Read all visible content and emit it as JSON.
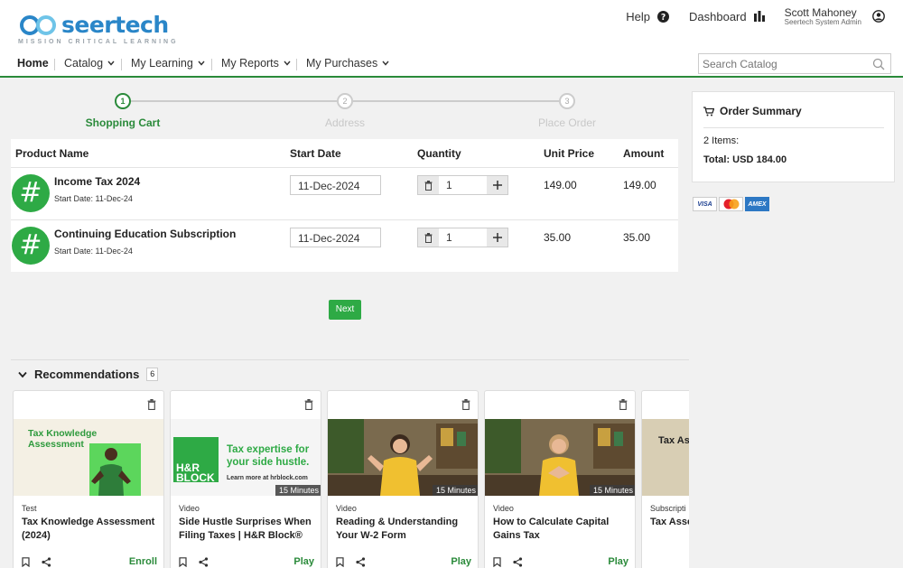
{
  "brand": {
    "name": "seertech",
    "tagline": "MISSION CRITICAL LEARNING"
  },
  "header": {
    "help": "Help",
    "dashboard": "Dashboard",
    "user_name": "Scott Mahoney",
    "user_role": "Seertech System Admin"
  },
  "nav": {
    "items": [
      {
        "label": "Home"
      },
      {
        "label": "Catalog"
      },
      {
        "label": "My Learning"
      },
      {
        "label": "My Reports"
      },
      {
        "label": "My Purchases"
      }
    ],
    "search_placeholder": "Search Catalog"
  },
  "steps": [
    {
      "num": "1",
      "label": "Shopping Cart"
    },
    {
      "num": "2",
      "label": "Address"
    },
    {
      "num": "3",
      "label": "Place Order"
    }
  ],
  "cart": {
    "headers": {
      "product": "Product Name",
      "start": "Start Date",
      "qty": "Quantity",
      "unit": "Unit Price",
      "amount": "Amount"
    },
    "rows": [
      {
        "icon": "#",
        "name": "Income Tax 2024",
        "sub": "Start Date: 11-Dec-24",
        "date": "11-Dec-2024",
        "qty": "1",
        "unit": "149.00",
        "amount": "149.00"
      },
      {
        "icon": "#",
        "name": "Continuing Education Subscription",
        "sub": "Start Date: 11-Dec-24",
        "date": "11-Dec-2024",
        "qty": "1",
        "unit": "35.00",
        "amount": "35.00"
      }
    ],
    "next": "Next"
  },
  "summary": {
    "title": "Order Summary",
    "items": "2 Items:",
    "total": "Total: USD 184.00",
    "cards": [
      "VISA",
      "mastercard-icon",
      "AMEX"
    ]
  },
  "recommendations": {
    "title": "Recommendations",
    "count": "6",
    "cards": [
      {
        "type": "Test",
        "title": "Tax Knowledge Assessment (2024)",
        "action": "Enroll",
        "thumb_text": "Tax Knowledge Assessment",
        "duration": ""
      },
      {
        "type": "Video",
        "title": "Side Hustle Surprises When Filing Taxes | H&R Block®",
        "action": "Play",
        "thumb_text": "Tax expertise for your side hustle.",
        "thumb_sub": "Learn more at hrblock.com",
        "thumb_logo": "H&R BLOCK",
        "duration": "15 Minutes"
      },
      {
        "type": "Video",
        "title": "Reading & Understanding Your W-2 Form",
        "action": "Play",
        "duration": "15 Minutes"
      },
      {
        "type": "Video",
        "title": "How to Calculate Capital Gains Tax",
        "action": "Play",
        "duration": "15 Minutes"
      },
      {
        "type": "Subscripti",
        "title": "Tax Asse",
        "action": "",
        "thumb_text": "Tax As",
        "duration": ""
      }
    ]
  },
  "colors": {
    "brand_blue": "#2a86c8",
    "accent_green": "#2a8a3a",
    "button_green": "#2eaa45"
  }
}
